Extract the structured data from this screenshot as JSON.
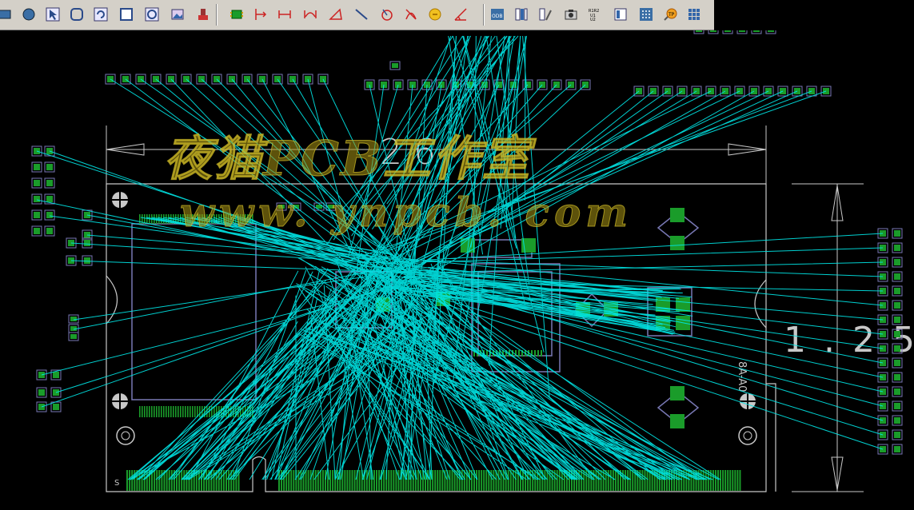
{
  "toolbar": {
    "buttons": [
      {
        "icon": "rectangle-icon"
      },
      {
        "icon": "circle-icon"
      },
      {
        "icon": "select-pointer-icon"
      },
      {
        "icon": "rounded-rect-icon"
      },
      {
        "icon": "rotate-icon"
      },
      {
        "icon": "square-icon"
      },
      {
        "icon": "circle-pad-icon"
      },
      {
        "icon": "image-icon"
      },
      {
        "icon": "stamp-icon"
      },
      {
        "icon": "component-icon"
      },
      {
        "icon": "dimension-vertical-icon"
      },
      {
        "icon": "dimension-horizontal-icon"
      },
      {
        "icon": "dimension-arc-icon"
      },
      {
        "icon": "angle-icon"
      },
      {
        "icon": "line-icon"
      },
      {
        "icon": "radius-icon"
      },
      {
        "icon": "cross-icon"
      },
      {
        "icon": "coin-icon"
      },
      {
        "icon": "angle-measure-icon"
      },
      {
        "icon": "odb-export-icon"
      },
      {
        "icon": "layer-stack-icon"
      },
      {
        "icon": "tools-icon"
      },
      {
        "icon": "camera-icon"
      },
      {
        "icon": "renumber-icon"
      },
      {
        "icon": "report-icon"
      },
      {
        "icon": "grid-icon"
      },
      {
        "icon": "test-point-icon"
      },
      {
        "icon": "array-icon"
      }
    ],
    "odb_label": "ODB",
    "renumber_label": "R1R2\nU1\nU2",
    "testpoint_label": "TP"
  },
  "watermark": {
    "title": "夜猫PCB工作室",
    "url": "www. ynpcb. com"
  },
  "board": {
    "dim_horizontal": "2.6",
    "dim_vertical": "1.25",
    "silk_label": "8A-A0",
    "corner_label": "S"
  },
  "colors": {
    "background": "#000000",
    "ratsnest": "#00e5e5",
    "pad": "#1a9c2a",
    "outline": "#c8c8c8",
    "component": "#7878b4",
    "watermark": "#aa9614"
  }
}
